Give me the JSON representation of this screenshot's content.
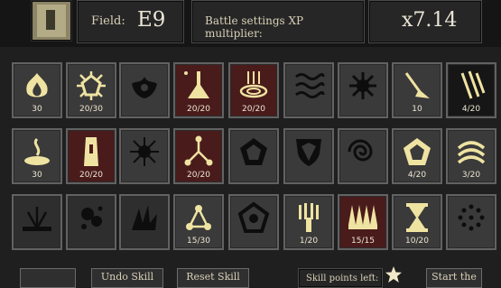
{
  "header": {
    "field_label": "Field:",
    "field_value": "E9",
    "xp_label": "Battle settings XP multiplier:",
    "xp_value": "x7.14"
  },
  "rows": [
    [
      {
        "icon": "fire-burst-icon",
        "count": "30",
        "state": "normal"
      },
      {
        "icon": "pentagon-flare-icon",
        "count": "20/30",
        "state": "normal"
      },
      {
        "icon": "dark-splash-icon",
        "count": "",
        "state": "normal"
      },
      {
        "icon": "beam-strike-icon",
        "count": "20/20",
        "state": "learned"
      },
      {
        "icon": "vortex-column-icon",
        "count": "20/20",
        "state": "learned"
      },
      {
        "icon": "wave-lines-icon",
        "count": "",
        "state": "normal"
      },
      {
        "icon": "dark-burst-icon",
        "count": "",
        "state": "normal"
      },
      {
        "icon": "meteor-icon",
        "count": "10",
        "state": "normal"
      },
      {
        "icon": "triple-slash-icon",
        "count": "4/20",
        "state": "dark"
      }
    ],
    [
      {
        "icon": "rising-smoke-icon",
        "count": "30",
        "state": "normal"
      },
      {
        "icon": "tower-icon",
        "count": "20/20",
        "state": "learned"
      },
      {
        "icon": "spiky-orb-icon",
        "count": "",
        "state": "normal"
      },
      {
        "icon": "branching-star-icon",
        "count": "20/20",
        "state": "learned"
      },
      {
        "icon": "pentagon-shield-icon",
        "count": "",
        "state": "normal"
      },
      {
        "icon": "crest-shield-icon",
        "count": "",
        "state": "normal"
      },
      {
        "icon": "spiral-icon",
        "count": "",
        "state": "normal"
      },
      {
        "icon": "gem-pentagon-icon",
        "count": "4/20",
        "state": "normal"
      },
      {
        "icon": "arcs-icon",
        "count": "3/20",
        "state": "normal"
      }
    ],
    [
      {
        "icon": "ground-burst-icon",
        "count": "",
        "state": "locked"
      },
      {
        "icon": "splatter-icon",
        "count": "",
        "state": "locked"
      },
      {
        "icon": "claw-splash-icon",
        "count": "",
        "state": "locked"
      },
      {
        "icon": "triple-node-icon",
        "count": "15/30",
        "state": "normal"
      },
      {
        "icon": "pentagon-ring-icon",
        "count": "",
        "state": "normal"
      },
      {
        "icon": "bar-fan-icon",
        "count": "1/20",
        "state": "normal"
      },
      {
        "icon": "spikes-row-icon",
        "count": "15/15",
        "state": "learned"
      },
      {
        "icon": "hourglass-icon",
        "count": "10/20",
        "state": "normal"
      },
      {
        "icon": "dot-cluster-icon",
        "count": "",
        "state": "normal"
      }
    ]
  ],
  "footer": {
    "undo_label": "Undo Skill",
    "reset_label": "Reset Skill",
    "points_label": "Skill points left:",
    "start_label": "Start the"
  }
}
